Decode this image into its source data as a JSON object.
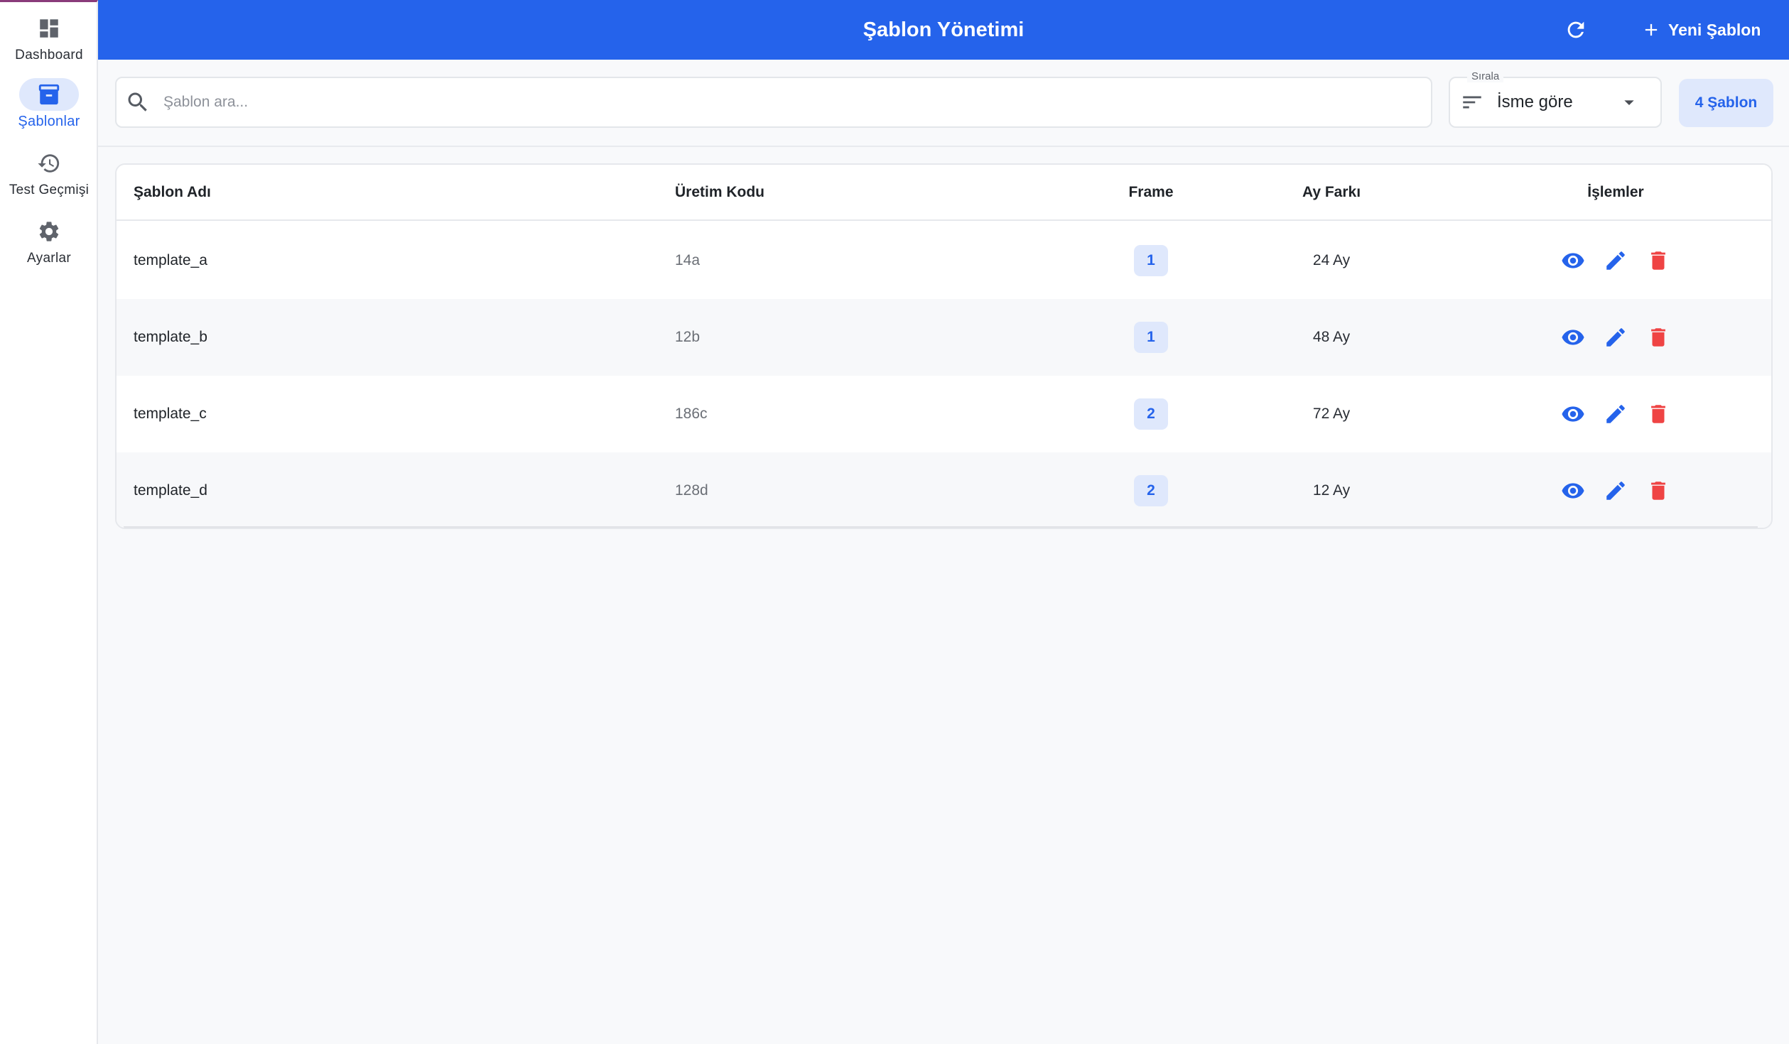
{
  "sidebar": {
    "items": [
      {
        "label": "Dashboard",
        "icon": "dashboard-icon",
        "active": false
      },
      {
        "label": "Şablonlar",
        "icon": "archive-icon",
        "active": true
      },
      {
        "label": "Test Geçmişi",
        "icon": "history-icon",
        "active": false
      },
      {
        "label": "Ayarlar",
        "icon": "gear-icon",
        "active": false
      }
    ]
  },
  "header": {
    "title": "Şablon Yönetimi",
    "refresh_icon": "refresh-icon",
    "new_button_label": "Yeni Şablon"
  },
  "toolbar": {
    "search_placeholder": "Şablon ara...",
    "search_value": "",
    "sort_label": "Sırala",
    "sort_value": "İsme göre",
    "count_label": "4 Şablon"
  },
  "table": {
    "columns": [
      "Şablon Adı",
      "Üretim Kodu",
      "Frame",
      "Ay Farkı",
      "İşlemler"
    ],
    "rows": [
      {
        "name": "template_a",
        "code": "14a",
        "frame": "1",
        "months": "24 Ay"
      },
      {
        "name": "template_b",
        "code": "12b",
        "frame": "1",
        "months": "48 Ay"
      },
      {
        "name": "template_c",
        "code": "186c",
        "frame": "2",
        "months": "72 Ay"
      },
      {
        "name": "template_d",
        "code": "128d",
        "frame": "2",
        "months": "12 Ay"
      }
    ],
    "row_actions": [
      "view-icon",
      "edit-icon",
      "delete-icon"
    ]
  },
  "colors": {
    "primary": "#2563eb",
    "primary_light": "#dfe8fc",
    "danger": "#ef4444",
    "background": "#f8f9fb"
  }
}
